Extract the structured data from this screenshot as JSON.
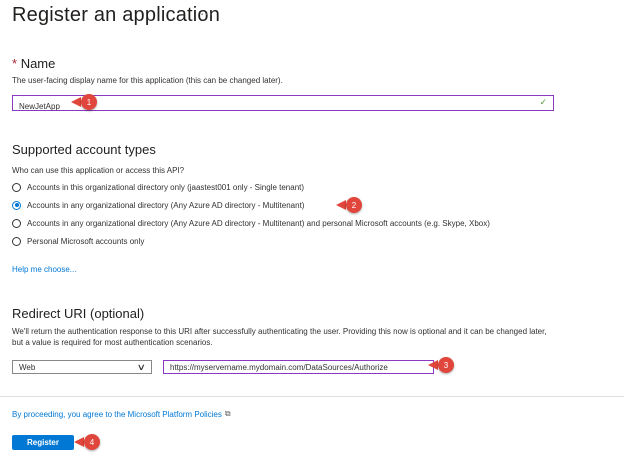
{
  "page": {
    "title": "Register an application",
    "more": "···"
  },
  "name_section": {
    "required_mark": "*",
    "label": "Name",
    "description": "The user-facing display name for this application (this can be changed later).",
    "value": "NewJetApp",
    "valid_icon": "checkmark-icon"
  },
  "account_types": {
    "heading": "Supported account types",
    "question": "Who can use this application or access this API?",
    "options": [
      {
        "label": "Accounts in this organizational directory only (jaastest001 only - Single tenant)",
        "checked": false
      },
      {
        "label": "Accounts in any organizational directory (Any Azure AD directory - Multitenant)",
        "checked": true
      },
      {
        "label": "Accounts in any organizational directory (Any Azure AD directory - Multitenant) and personal Microsoft accounts (e.g. Skype, Xbox)",
        "checked": false
      },
      {
        "label": "Personal Microsoft accounts only",
        "checked": false
      }
    ],
    "help_link": "Help me choose..."
  },
  "redirect": {
    "heading": "Redirect URI (optional)",
    "description": "We'll return the authentication response to this URI after successfully authenticating the user. Providing this now is optional and it can be changed later, but a value is required for most authentication scenarios.",
    "platform": "Web",
    "uri": "https://myservername.mydomain.com/DataSources/Authorize"
  },
  "footer": {
    "policy_text": "By proceeding, you agree to the Microsoft Platform Policies",
    "register_label": "Register"
  },
  "markers": [
    "1",
    "2",
    "3",
    "4"
  ],
  "colors": {
    "accent": "#0078d4",
    "marker": "#e0463b",
    "focus_border": "#8a3ac1"
  }
}
